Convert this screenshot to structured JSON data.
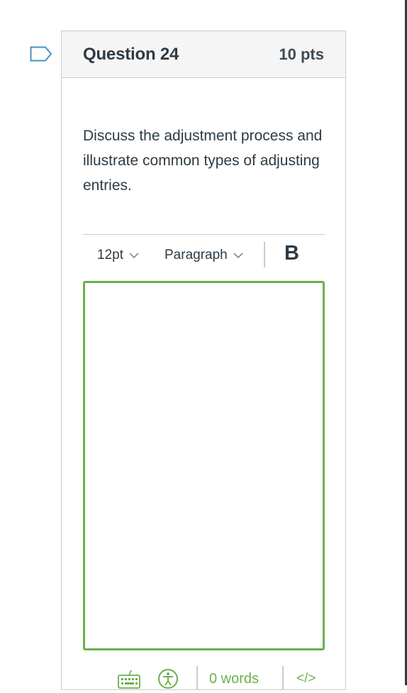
{
  "question": {
    "title": "Question 24",
    "points": "10 pts",
    "text": "Discuss the adjustment process and illustrate common types of adjusting entries."
  },
  "toolbar": {
    "font_size": "12pt",
    "block_format": "Paragraph",
    "bold_label": "B"
  },
  "editor": {
    "content": ""
  },
  "statusbar": {
    "word_count": "0 words",
    "html_toggle": "</>"
  },
  "colors": {
    "accent_green": "#6ab04c",
    "text": "#2d3b45",
    "header_bg": "#f5f5f5",
    "border": "#c7cdd1"
  },
  "icons": [
    "flag-icon",
    "chevron-down-icon",
    "keyboard-icon",
    "accessibility-icon"
  ]
}
